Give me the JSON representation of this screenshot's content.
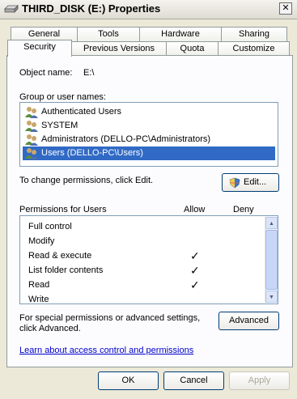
{
  "window": {
    "title": "THIRD_DISK (E:) Properties",
    "close_glyph": "✕"
  },
  "tabs_row1": [
    "General",
    "Tools",
    "Hardware",
    "Sharing"
  ],
  "tabs_row2": [
    "Security",
    "Previous Versions",
    "Quota",
    "Customize"
  ],
  "object": {
    "label": "Object name:",
    "value": "E:\\"
  },
  "groups": {
    "label": "Group or user names:",
    "items": [
      "Authenticated Users",
      "SYSTEM",
      "Administrators (DELLO-PC\\Administrators)",
      "Users (DELLO-PC\\Users)"
    ],
    "selected_index": 3
  },
  "change_perm_text": "To change permissions, click Edit.",
  "edit_button": "Edit...",
  "permissions": {
    "label": "Permissions for Users",
    "allow_header": "Allow",
    "deny_header": "Deny",
    "check_glyph": "✓",
    "rows": [
      {
        "name": "Full control",
        "allow": false,
        "deny": false
      },
      {
        "name": "Modify",
        "allow": false,
        "deny": false
      },
      {
        "name": "Read & execute",
        "allow": true,
        "deny": false
      },
      {
        "name": "List folder contents",
        "allow": true,
        "deny": false
      },
      {
        "name": "Read",
        "allow": true,
        "deny": false
      },
      {
        "name": "Write",
        "allow": false,
        "deny": false
      }
    ]
  },
  "special_text_1": "For special permissions or advanced settings,",
  "special_text_2": "click Advanced.",
  "advanced_button": "Advanced",
  "learn_link": "Learn about access control and permissions",
  "footer": {
    "ok": "OK",
    "cancel": "Cancel",
    "apply": "Apply"
  },
  "scroll_up_glyph": "▲",
  "scroll_down_glyph": "▼"
}
